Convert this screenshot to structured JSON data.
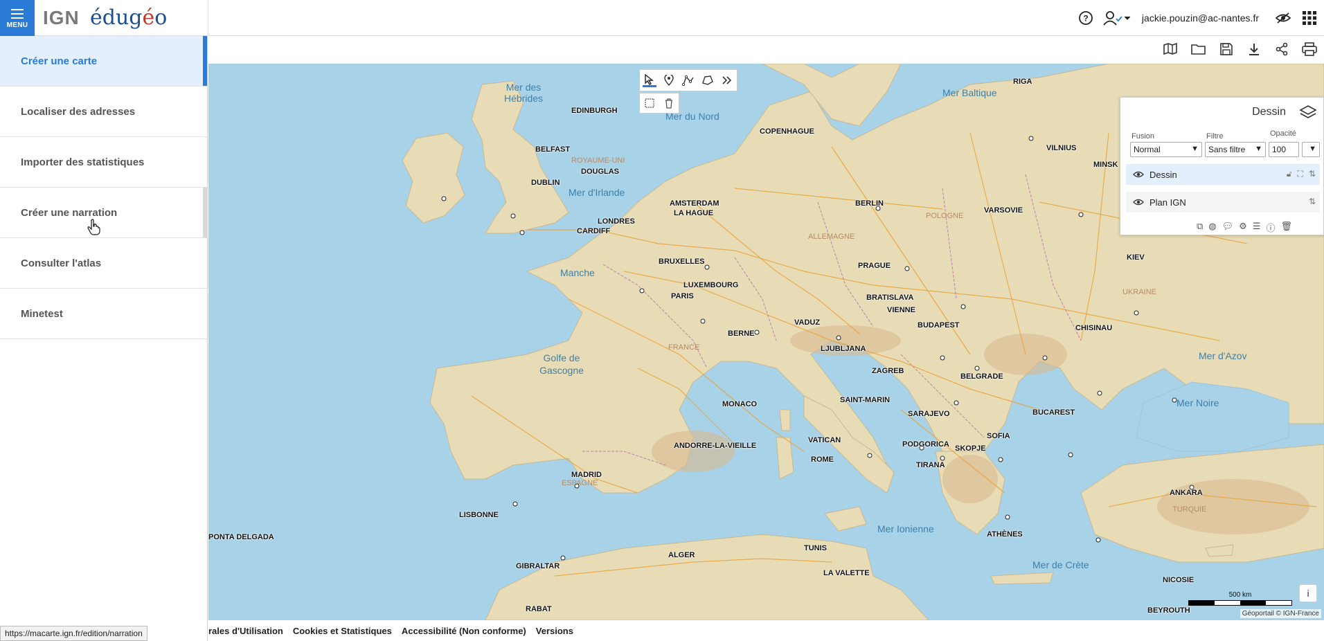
{
  "header": {
    "menu_label": "MENU",
    "logo_ign": "IGN",
    "logo_edu_a": "édug",
    "logo_edu_accent": "é",
    "logo_edu_b": "o",
    "user_email": "jackie.pouzin@ac-nantes.fr"
  },
  "sidebar": {
    "items": [
      {
        "label": "Créer une carte"
      },
      {
        "label": "Localiser des adresses"
      },
      {
        "label": "Importer des statistiques"
      },
      {
        "label": "Créer une narration"
      },
      {
        "label": "Consulter l'atlas"
      },
      {
        "label": "Minetest"
      }
    ]
  },
  "layers_panel": {
    "title": "Dessin",
    "fusion_label": "Fusion",
    "fusion_value": "Normal",
    "filter_label": "Filtre",
    "filter_value": "Sans filtre",
    "opacity_label": "Opacité",
    "opacity_value": "100",
    "layers": [
      {
        "name": "Dessin"
      },
      {
        "name": "Plan IGN"
      }
    ]
  },
  "map": {
    "seas": [
      "Mer des Hébrides",
      "Mer du Nord",
      "Mer Baltique",
      "Mer d'Irlande",
      "Manche",
      "Golfe de Gascogne",
      "Mer Ionienne",
      "Mer de Crète",
      "Mer Noire",
      "Mer d'Azov"
    ],
    "cities": [
      "EDINBURGH",
      "BELFAST",
      "DUBLIN",
      "DOUGLAS",
      "LONDRES",
      "CARDIFF",
      "AMSTERDAM",
      "LA HAGUE",
      "BRUXELLES",
      "LUXEMBOURG",
      "PARIS",
      "BERNE",
      "VADUZ",
      "MONACO",
      "ANDORRE-LA-VIEILLE",
      "MADRID",
      "LISBONNE",
      "GIBRALTAR",
      "RABAT",
      "ALGER",
      "TUNIS",
      "LA VALETTE",
      "ROME",
      "VATICAN",
      "SAINT-MARIN",
      "LJUBLJANA",
      "ZAGREB",
      "SARAJEVO",
      "PODGORICA",
      "TIRANA",
      "SKOPJE",
      "SOFIA",
      "BUCAREST",
      "ATHÈNES",
      "ANKARA",
      "NICOSIE",
      "BEYROUTH",
      "CHISINAU",
      "KIEV",
      "MINSK",
      "VILNIUS",
      "RIGA",
      "VARSOVIE",
      "BERLIN",
      "PRAGUE",
      "VIENNE",
      "BRATISLAVA",
      "BUDAPEST",
      "BELGRADE",
      "COPENHAGUE",
      "PONTA DELGADA"
    ],
    "countries": [
      "ROYAUME-UNI",
      "FRANCE",
      "ESPAGNE",
      "ALLEMAGNE",
      "POLOGNE",
      "UKRAINE",
      "TURQUIE"
    ],
    "scale_label": "500 km",
    "attribution": "Géoportail © IGN-France",
    "info_label": "i"
  },
  "footer": {
    "links": [
      "rales d'Utilisation",
      "Cookies et Statistiques",
      "Accessibilité (Non conforme)",
      "Versions"
    ]
  },
  "status_url": "https://macarte.ign.fr/edition/narration"
}
